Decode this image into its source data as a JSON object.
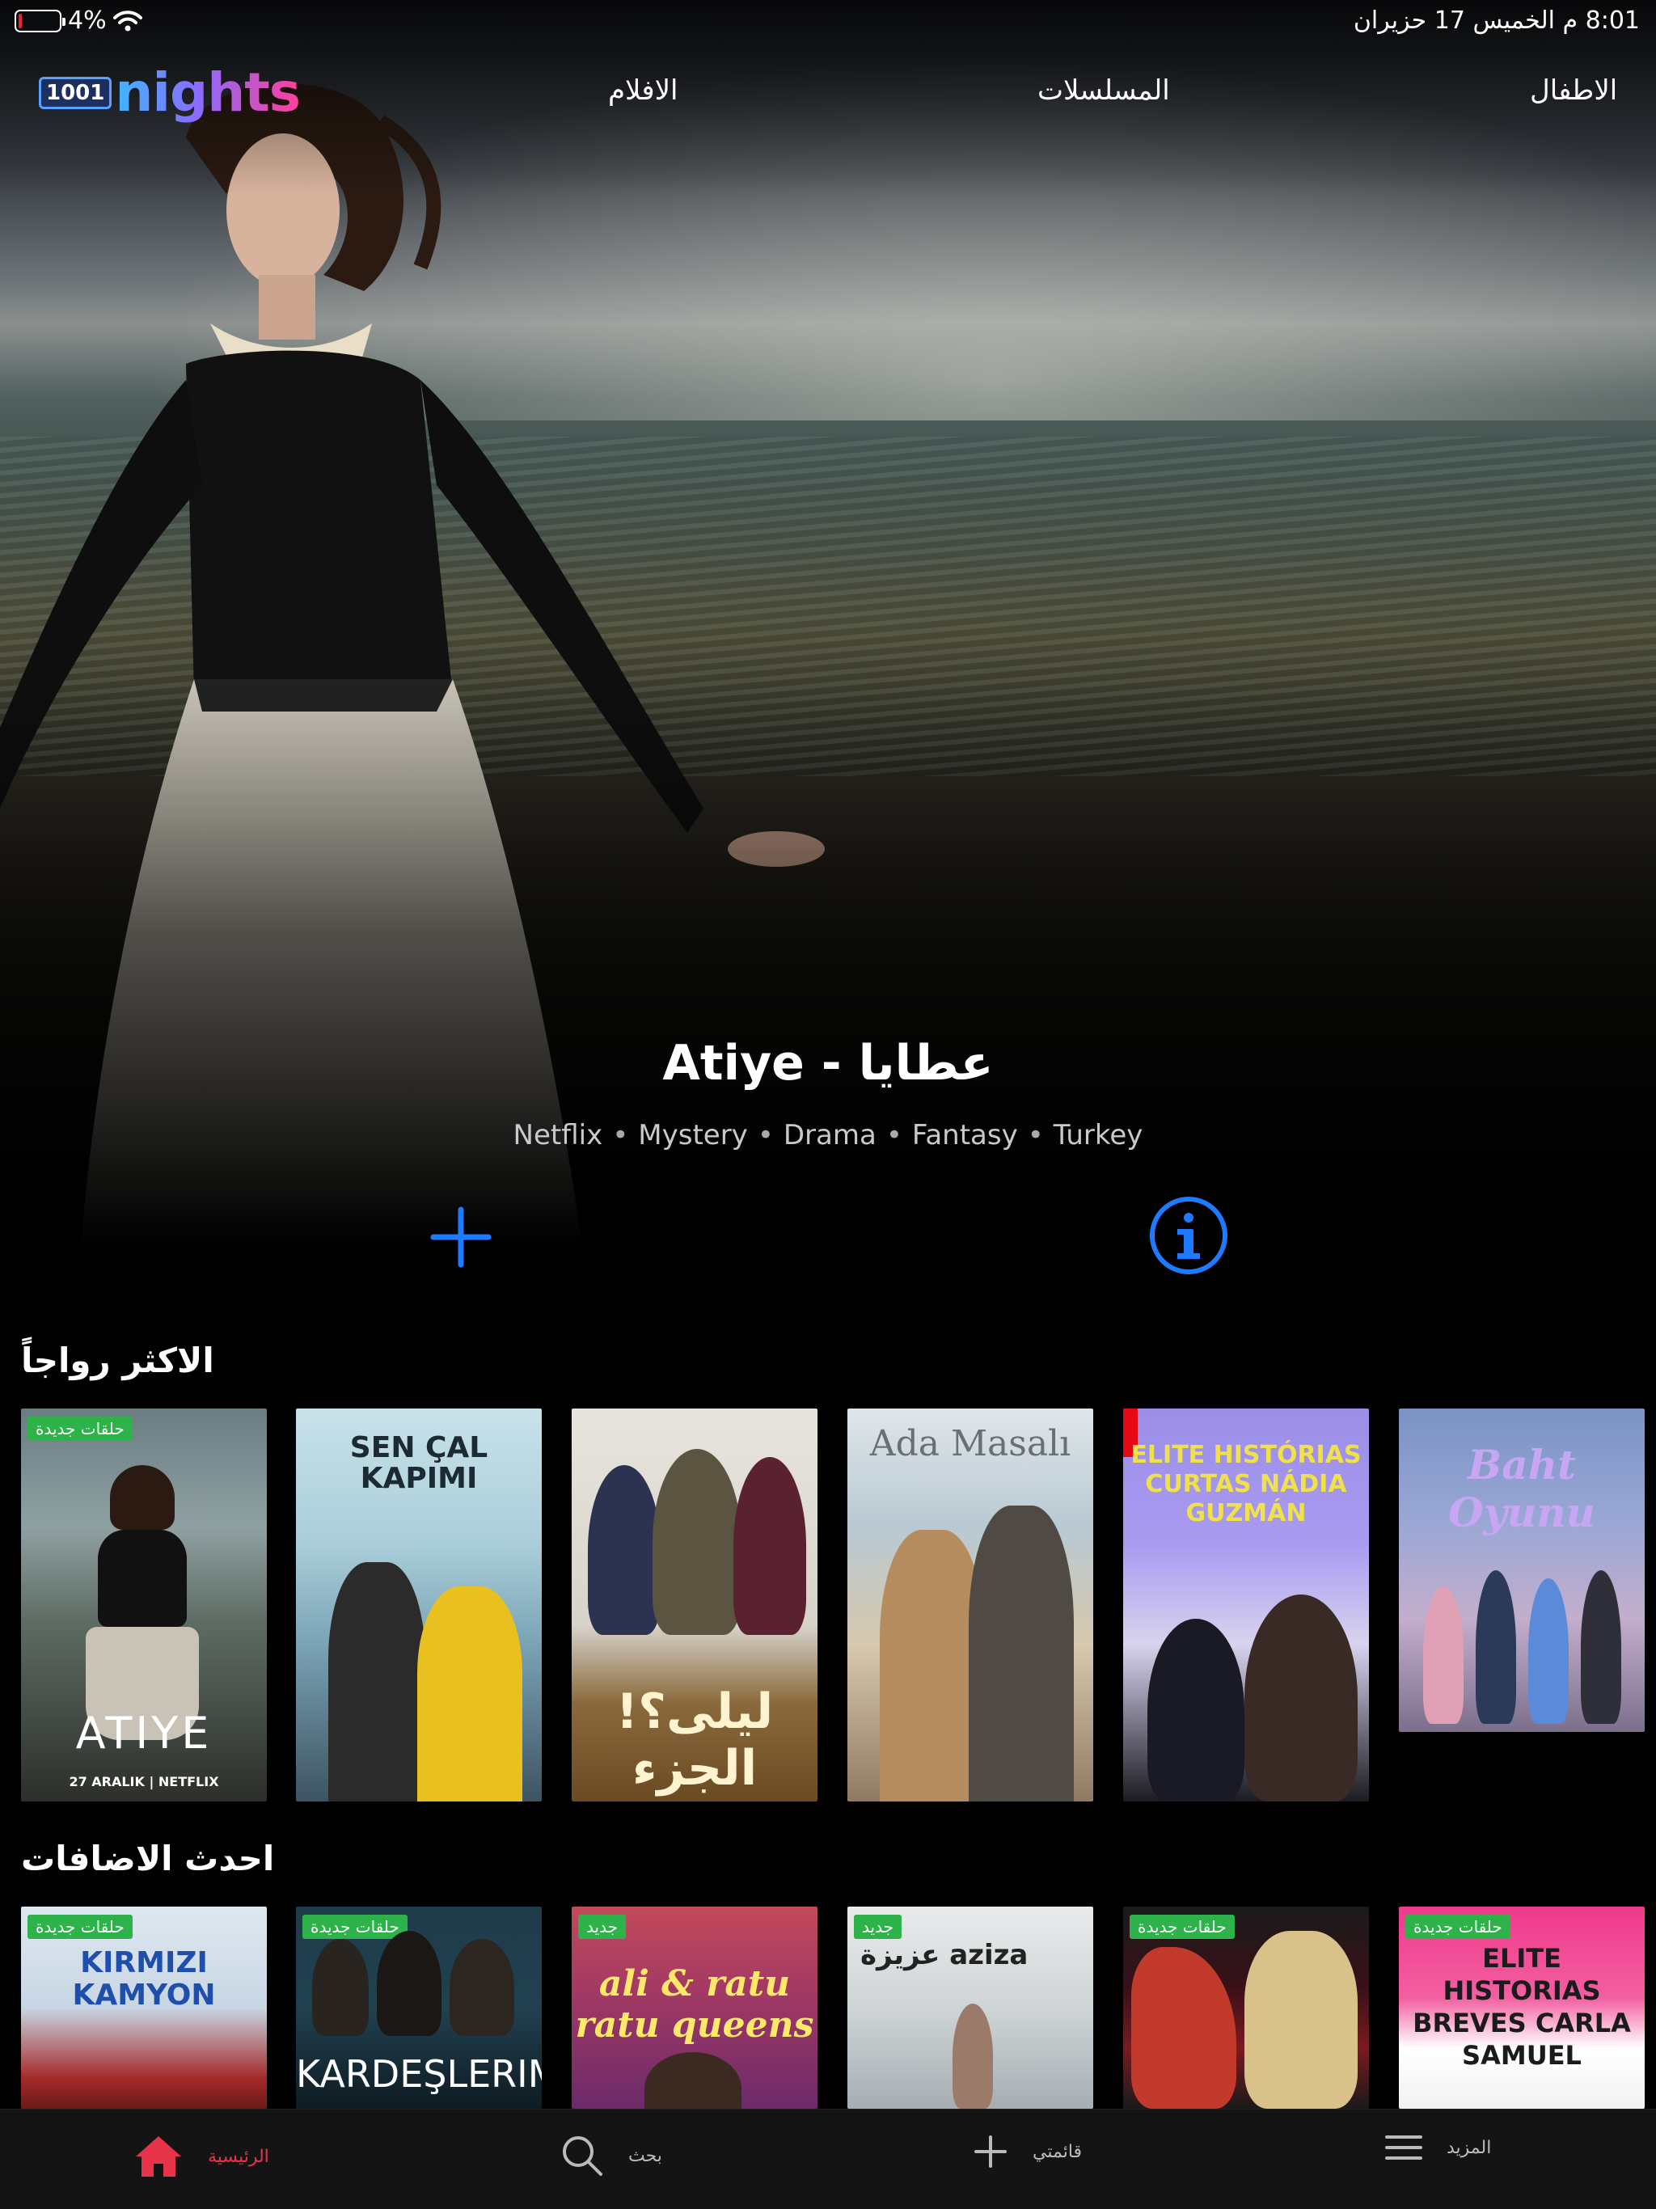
{
  "status_bar": {
    "battery": "4%",
    "datetime": "8:01 م  الخميس 17 حزيران"
  },
  "logo": {
    "box_text": "1001",
    "word": "nights"
  },
  "top_nav": [
    "الاطفال",
    "المسلسلات",
    "الافلام"
  ],
  "hero": {
    "title": "Atiye - عطايا",
    "tags": [
      "Netflix",
      "Mystery",
      "Drama",
      "Fantasy",
      "Turkey"
    ]
  },
  "rows": [
    {
      "title": "الاكثر رواجاً",
      "posters": [
        {
          "title": "ATIYE",
          "badge": "حلقات جديدة",
          "caption": "27 ARALIK | NETFLIX"
        },
        {
          "title": "SEN ÇAL KAPIMI",
          "badge": ""
        },
        {
          "title": "ليلى؟! الجزء الثاني",
          "badge": ""
        },
        {
          "title": "Ada Masalı",
          "badge": ""
        },
        {
          "title": "ELITE HISTÓRIAS CURTAS NÁDIA GUZMÁN",
          "badge": ""
        },
        {
          "title": "Baht Oyunu",
          "badge": ""
        }
      ]
    },
    {
      "title": "احدث الاضافات",
      "posters": [
        {
          "title": "KIRMIZI KAMYON",
          "badge": "حلقات جديدة"
        },
        {
          "title": "KARDEŞLERIM",
          "badge": "حلقات جديدة"
        },
        {
          "title": "ali & ratu ratu queens",
          "badge": "جديد"
        },
        {
          "title": "عزيزة aziza",
          "badge": "جديد"
        },
        {
          "title": "",
          "badge": "حلقات جديدة"
        },
        {
          "title": "ELITE HISTORIAS BREVES CARLA SAMUEL",
          "badge": "حلقات جديدة"
        }
      ]
    }
  ],
  "tab_bar": [
    {
      "label": "الرئيسية",
      "icon": "home-icon",
      "active": true
    },
    {
      "label": "بحث",
      "icon": "search-icon",
      "active": false
    },
    {
      "label": "قائمتي",
      "icon": "plus-icon",
      "active": false
    },
    {
      "label": "المزيد",
      "icon": "menu-icon",
      "active": false
    }
  ],
  "colors": {
    "accent_blue": "#1e7bff",
    "active_tab": "#e8344a",
    "badge_green": "#2db34a"
  }
}
